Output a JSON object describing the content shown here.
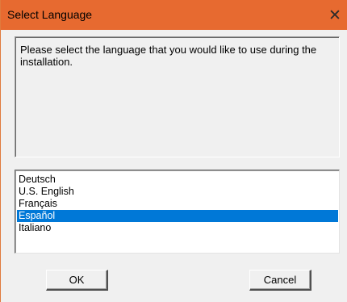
{
  "window": {
    "title": "Select Language",
    "close_glyph": "✕"
  },
  "message": {
    "text": "Please select the language that you would like to use during the installation."
  },
  "language_list": {
    "items": [
      "Deutsch",
      "U.S. English",
      "Français",
      "Español",
      "Italiano"
    ],
    "selected": "Español"
  },
  "buttons": {
    "ok_label": "OK",
    "cancel_label": "Cancel"
  },
  "colors": {
    "titlebar": "#e76a30",
    "selection": "#0078d7",
    "dialog_bg": "#f0f0f0"
  },
  "icons": {
    "close": "close-icon"
  }
}
